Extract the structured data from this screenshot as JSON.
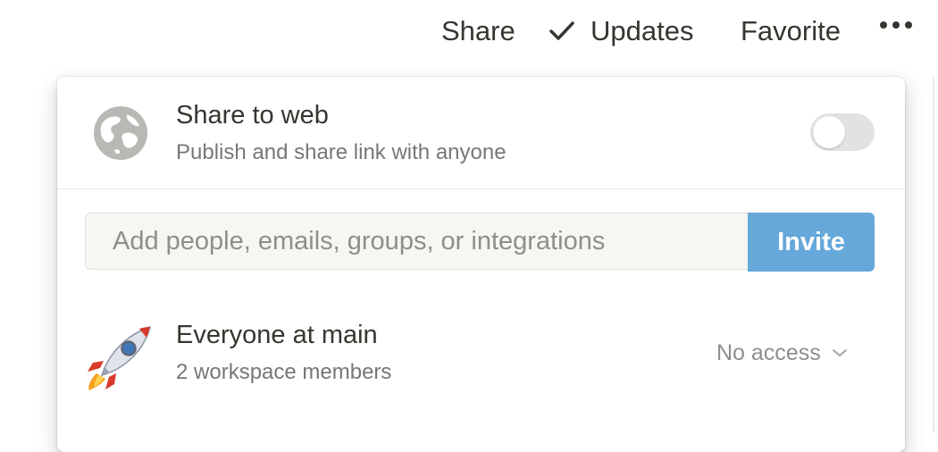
{
  "topbar": {
    "share_label": "Share",
    "updates_label": "Updates",
    "favorite_label": "Favorite",
    "more_icon": "more-horizontal-icon"
  },
  "share_panel": {
    "web": {
      "icon": "globe-icon",
      "title": "Share to web",
      "subtitle": "Publish and share link with anyone",
      "toggle_on": false
    },
    "invite": {
      "placeholder": "Add people, emails, groups, or integrations",
      "value": "",
      "button_label": "Invite",
      "button_color": "#65a8d9"
    },
    "members": [
      {
        "icon": "rocket-icon",
        "name": "Everyone at main",
        "subtitle": "2 workspace members",
        "access": "No access"
      }
    ]
  }
}
